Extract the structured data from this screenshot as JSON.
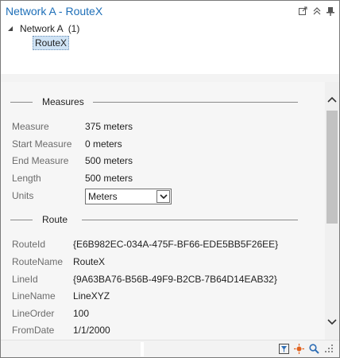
{
  "window": {
    "title": "Network A - RouteX",
    "icons": [
      "popout-icon",
      "collapse-icon",
      "pin-icon"
    ]
  },
  "tree": {
    "parent_label": "Network A",
    "parent_count": "(1)",
    "child_label": "RouteX"
  },
  "measures": {
    "title": "Measures",
    "rows": [
      {
        "label": "Measure",
        "value": "375 meters"
      },
      {
        "label": "Start Measure",
        "value": "0 meters"
      },
      {
        "label": "End Measure",
        "value": "500 meters"
      },
      {
        "label": "Length",
        "value": "500 meters"
      }
    ],
    "units_label": "Units",
    "units_value": "Meters"
  },
  "route": {
    "title": "Route",
    "rows": [
      {
        "label": "RouteId",
        "value": "{E6B982EC-034A-475F-BF66-EDE5BB5F26EE}"
      },
      {
        "label": "RouteName",
        "value": "RouteX"
      },
      {
        "label": "LineId",
        "value": "{9A63BA76-B56B-49F9-B2CB-7B64D14EAB32}"
      },
      {
        "label": "LineName",
        "value": "LineXYZ"
      },
      {
        "label": "LineOrder",
        "value": "100"
      },
      {
        "label": "FromDate",
        "value": "1/1/2000"
      }
    ]
  },
  "bottom_icons": [
    "filter-icon",
    "flash-icon",
    "zoom-icon"
  ],
  "colors": {
    "title": "#1e6fb8",
    "selection": "#cfe3f5",
    "label": "#6c6c6c"
  }
}
